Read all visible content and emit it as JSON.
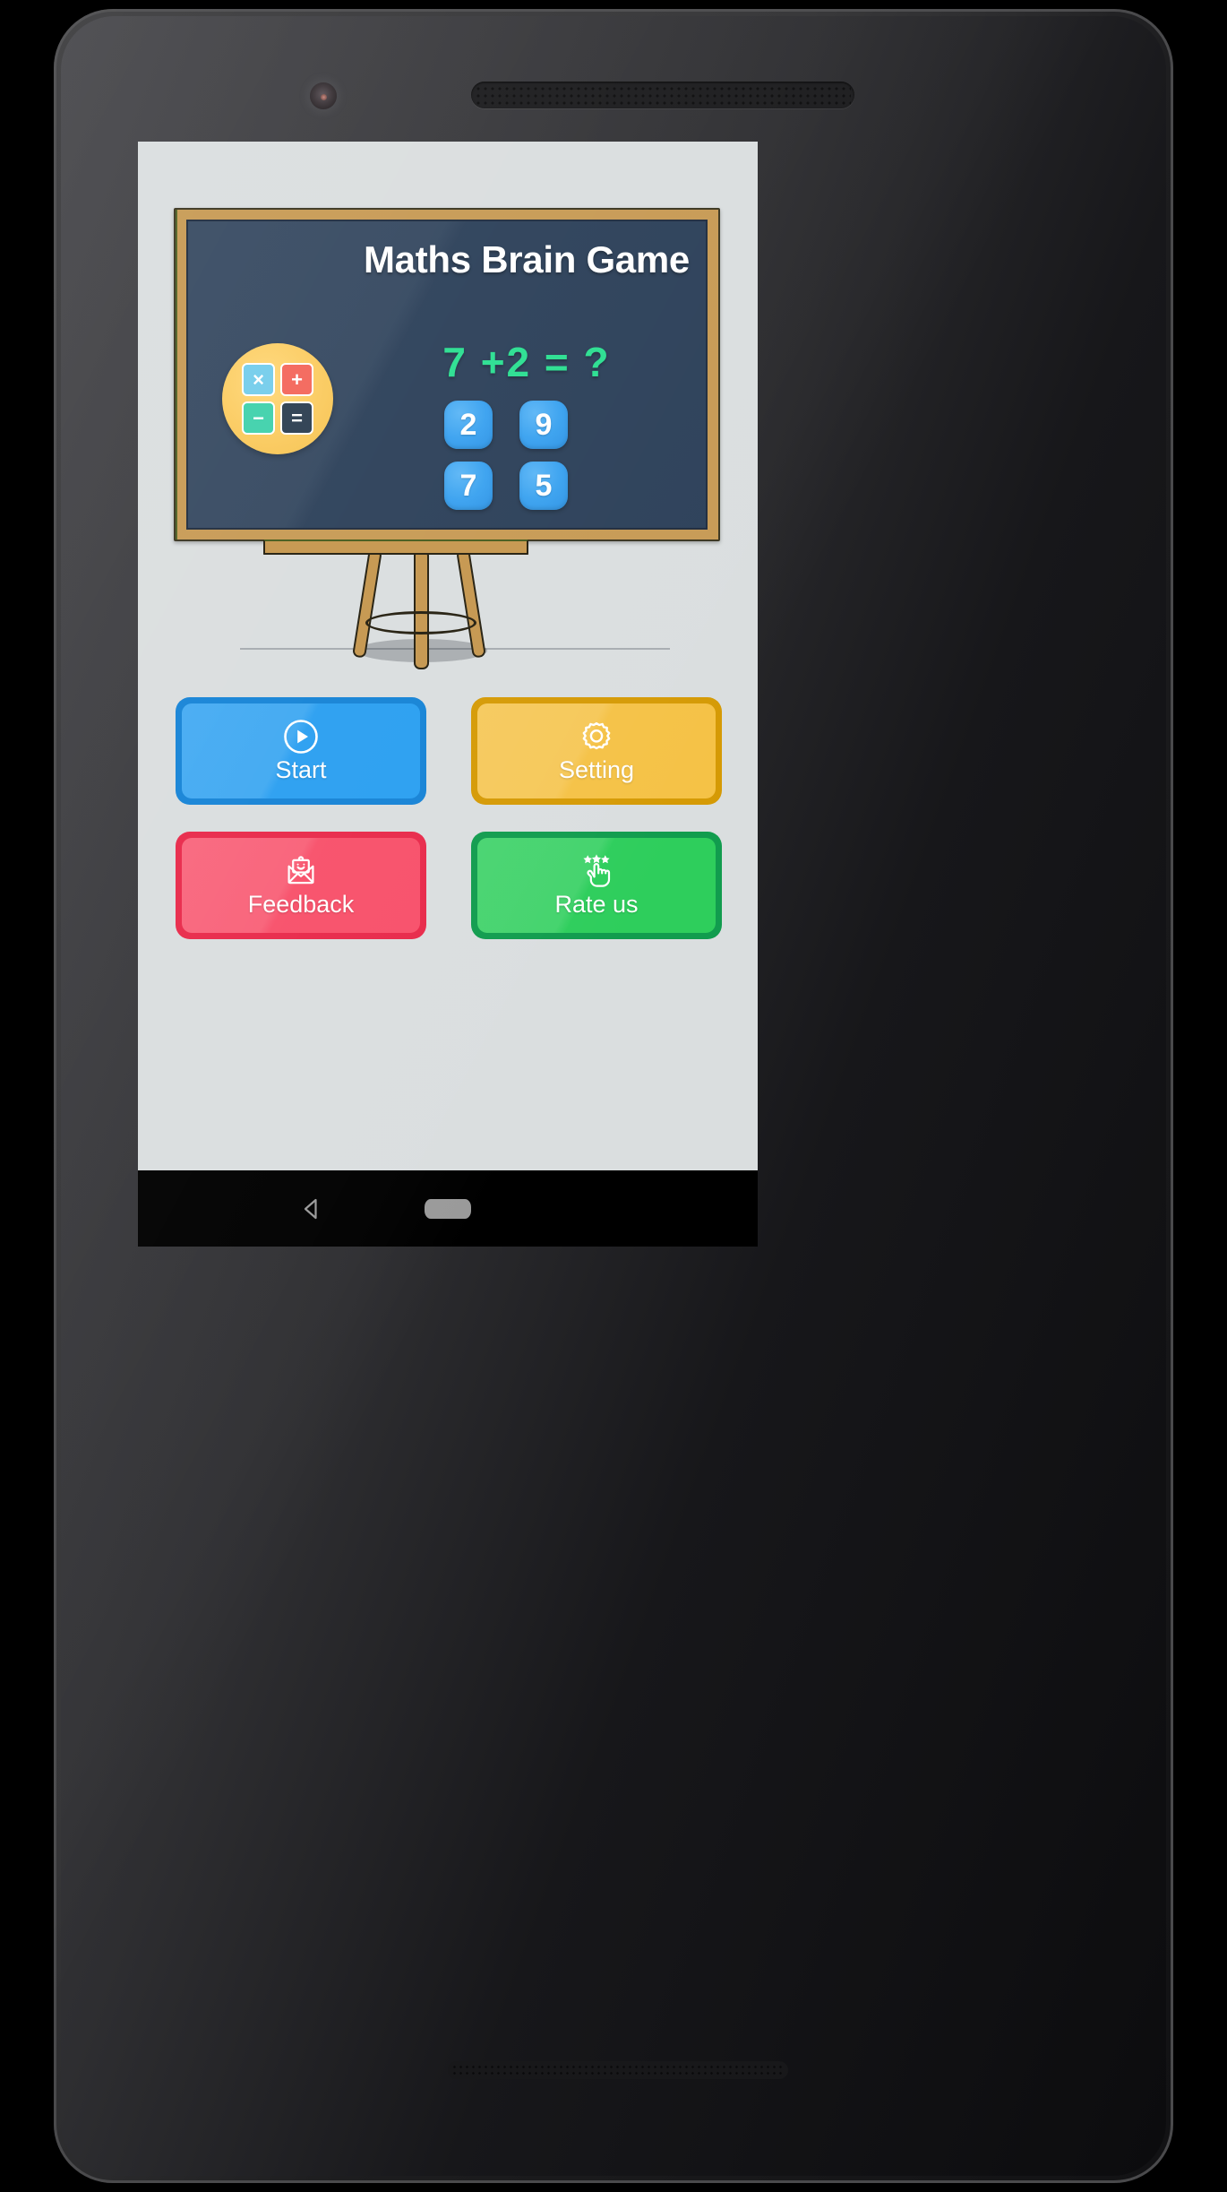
{
  "app": {
    "title": "Maths Brain Game",
    "screen_background": "#dadedf"
  },
  "chalkboard": {
    "title": "Maths Brain Game",
    "board_color": "#2c4059",
    "frame_color": "#c79a54",
    "equation": {
      "text": "7 +2 = ?",
      "operand_left": "7",
      "operator": "+",
      "operand_right": "2",
      "equals": "=",
      "unknown": "?",
      "color": "#2bdf91"
    },
    "answers": [
      {
        "value": "2",
        "name": "answer-option-2"
      },
      {
        "value": "9",
        "name": "answer-option-9"
      },
      {
        "value": "7",
        "name": "answer-option-7"
      },
      {
        "value": "5",
        "name": "answer-option-5"
      }
    ],
    "answer_tile_color": "#3aa2f0"
  },
  "logo": {
    "name": "calculator-logo",
    "circle_color": "#f5c24f",
    "tiles": [
      {
        "glyph": "×",
        "color": "#74cdeb",
        "name": "multiply-tile"
      },
      {
        "glyph": "+",
        "color": "#f4665b",
        "name": "plus-tile"
      },
      {
        "glyph": "−",
        "color": "#3fd1ab",
        "name": "minus-tile"
      },
      {
        "glyph": "=",
        "color": "#2c3e50",
        "name": "equals-tile"
      }
    ]
  },
  "menu": {
    "buttons": [
      {
        "label": "Start",
        "icon": "play-circle-icon",
        "fill": "#2a9ff1",
        "border": "#1583d6"
      },
      {
        "label": "Setting",
        "icon": "gear-icon",
        "fill": "#f5c246",
        "border": "#d59a05"
      },
      {
        "label": "Feedback",
        "icon": "envelope-smile-icon",
        "fill": "#f8506a",
        "border": "#e8294a"
      },
      {
        "label": "Rate us",
        "icon": "stars-hand-icon",
        "fill": "#2ece5c",
        "border": "#119c4e"
      }
    ]
  },
  "nav_bar": {
    "back": "back-triangle-icon",
    "home": "home-pill-icon",
    "background": "#000000"
  },
  "device": {
    "front_camera": "front-camera",
    "earpiece": "earpiece-speaker",
    "bottom_speaker": "bottom-speaker",
    "power_button": "power-button",
    "volume_button": "volume-button"
  }
}
